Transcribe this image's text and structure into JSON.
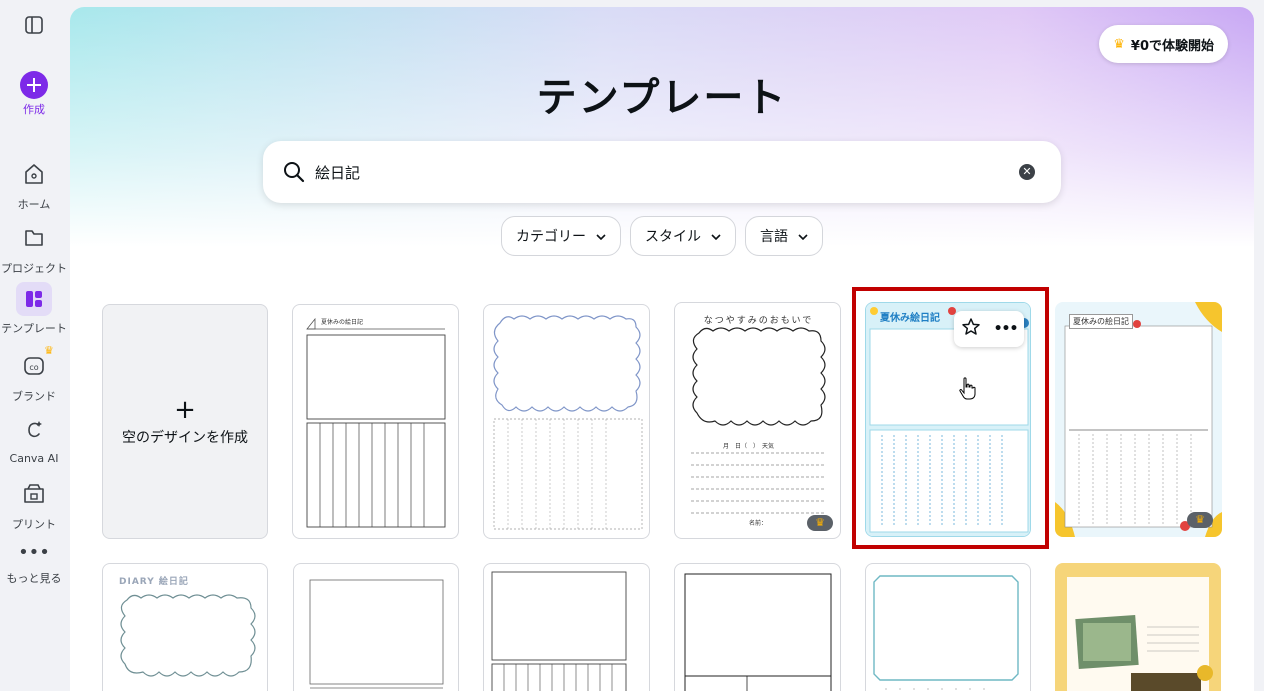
{
  "sidebar": {
    "items": [
      {
        "label": "作成",
        "icon": "plus-circle-icon"
      },
      {
        "label": "ホーム",
        "icon": "home-icon"
      },
      {
        "label": "プロジェクト",
        "icon": "folder-icon"
      },
      {
        "label": "テンプレート",
        "icon": "template-icon"
      },
      {
        "label": "ブランド",
        "icon": "brand-icon"
      },
      {
        "label": "Canva AI",
        "icon": "canva-ai-icon"
      },
      {
        "label": "プリント",
        "icon": "print-icon"
      },
      {
        "label": "もっと見る",
        "icon": "more-icon"
      }
    ]
  },
  "header": {
    "trial_label": "¥0で体験開始",
    "title": "テンプレート"
  },
  "search": {
    "value": "絵日記"
  },
  "filters": [
    {
      "label": "カテゴリー"
    },
    {
      "label": "スタイル"
    },
    {
      "label": "言語"
    }
  ],
  "blank_card": {
    "label": "空のデザインを作成"
  },
  "templates": [
    {
      "title": "夏休みの絵日記"
    },
    {
      "title": ""
    },
    {
      "title": "なつやすみのおもいで",
      "footer": "月　日（　）　天気",
      "name_label": "名前："
    },
    {
      "title": "夏休み絵日記"
    },
    {
      "title": "夏休みの絵日記"
    },
    {
      "title": "DIARY 絵日記"
    },
    {
      "title": ""
    },
    {
      "title": ""
    },
    {
      "title": ""
    },
    {
      "title": ""
    },
    {
      "title": ""
    }
  ],
  "colors": {
    "accent": "#7d2ae8",
    "highlight": "#c10000",
    "crown": "#ffb300"
  }
}
